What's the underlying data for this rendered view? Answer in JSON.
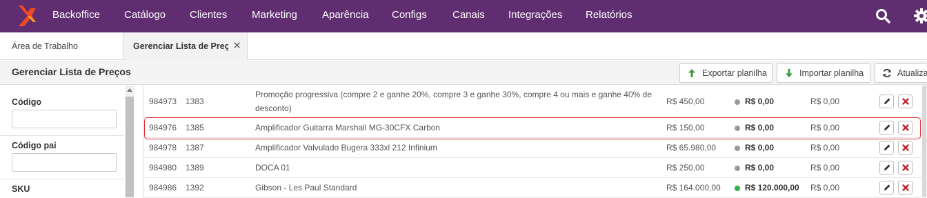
{
  "nav": {
    "items": [
      {
        "key": "backoffice",
        "label": "Backoffice"
      },
      {
        "key": "catalogo",
        "label": "Catálogo"
      },
      {
        "key": "clientes",
        "label": "Clientes"
      },
      {
        "key": "marketing",
        "label": "Marketing"
      },
      {
        "key": "aparencia",
        "label": "Aparência"
      },
      {
        "key": "configs",
        "label": "Configs"
      },
      {
        "key": "canais",
        "label": "Canais"
      },
      {
        "key": "integracoes",
        "label": "Integrações"
      },
      {
        "key": "relatorios",
        "label": "Relatórios"
      }
    ],
    "bg_color": "#5f2d70",
    "logo_color": "#ee4b25",
    "icons": [
      "search-icon",
      "gear-icon"
    ]
  },
  "tabs": [
    {
      "label": "Área de Trabalho",
      "active": false
    },
    {
      "label": "Gerenciar Lista de Preços",
      "active": true,
      "close": "✕"
    }
  ],
  "header": {
    "title": "Gerenciar Lista de Preços",
    "buttons": {
      "export": {
        "label": "Exportar planilha",
        "icon": "arrow-up-icon",
        "color": "#3a9a3a"
      },
      "import": {
        "label": "Importar planilha",
        "icon": "arrow-down-icon",
        "color": "#3a9a3a"
      },
      "refresh": {
        "label": "Atualizar",
        "icon": "refresh-icon"
      }
    }
  },
  "filters": {
    "codigo": {
      "label": "Código",
      "value": ""
    },
    "codigo_pai": {
      "label": "Código pai",
      "value": ""
    },
    "sku": {
      "label": "SKU"
    }
  },
  "rows": [
    {
      "id": "984973",
      "parent": "1383",
      "desc": "Promoção progressiva (compre 2 e ganhe 20%, compre 3 e ganhe 30%, compre 4 ou mais e ganhe 40% de desconto)",
      "price": "R$ 450,00",
      "promo": "R$ 0,00",
      "status": "gray",
      "extra": "R$ 0,00"
    },
    {
      "id": "984976",
      "parent": "1385",
      "desc": "Amplificador Guitarra Marshall MG-30CFX Carbon",
      "price": "R$ 150,00",
      "promo": "R$ 0,00",
      "status": "gray",
      "extra": "R$ 0,00",
      "highlighted": true
    },
    {
      "id": "984978",
      "parent": "1387",
      "desc": "Amplificador Valvulado Bugera 333xl 212 Infinium",
      "price": "R$ 65.980,00",
      "promo": "R$ 0,00",
      "status": "gray",
      "extra": "R$ 0,00"
    },
    {
      "id": "984980",
      "parent": "1389",
      "desc": "DOCA 01",
      "price": "R$ 250,00",
      "promo": "R$ 0,00",
      "status": "gray",
      "extra": "R$ 0,00"
    },
    {
      "id": "984986",
      "parent": "1392",
      "desc": "Gibson - Les Paul Standard",
      "price": "R$ 164.000,00",
      "promo": "R$ 120.000,00",
      "status": "green",
      "extra": "R$ 0,00"
    }
  ],
  "status_colors": {
    "gray": "#9a9a9a",
    "green": "#2db34a"
  },
  "highlight_color": "#e0313a"
}
